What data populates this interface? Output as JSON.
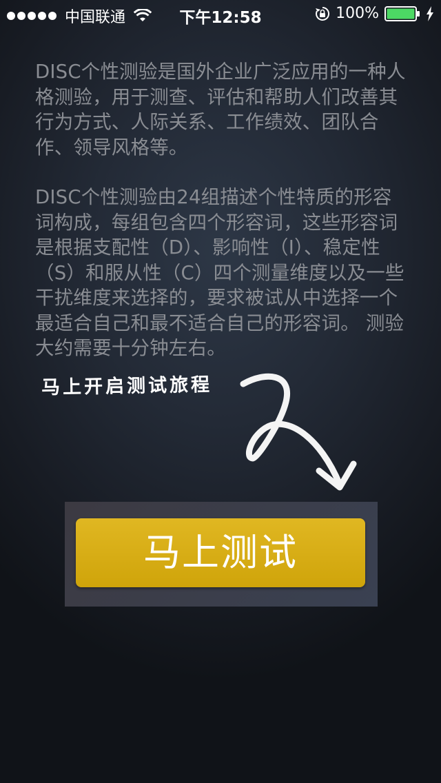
{
  "status_bar": {
    "carrier": "中国联通",
    "time": "下午12:58",
    "battery_percent": "100%",
    "battery_level": 1.0,
    "signal_bars": 5,
    "icons": [
      "signal-dots-icon",
      "wifi-icon",
      "rotation-lock-icon",
      "battery-icon",
      "charging-bolt-icon"
    ]
  },
  "intro": {
    "paragraph_1": "DISC个性测验是国外企业广泛应用的一种人格测验，用于测查、评估和帮助人们改善其行为方式、人际关系、工作绩效、团队合作、领导风格等。",
    "paragraph_2": "DISC个性测验由24组描述个性特质的形容词构成，每组包含四个形容词，这些形容词是根据支配性（D）、影响性（I）、稳定性（S）和服从性（C）四个测量维度以及一些干扰维度来选择的，要求被试从中选择一个最适合自己和最不适合自己的形容词。 测验大约需要十分钟左右。"
  },
  "caption": {
    "text": "马上开启测试旅程",
    "icon": "hand-drawn-arrow-icon"
  },
  "actions": {
    "start_test_label": "马上测试"
  },
  "colors": {
    "button_yellow": "#d6ac12",
    "text_gray": "#8a8d93",
    "background_dark": "#1c2129",
    "battery_green": "#4cd964"
  }
}
